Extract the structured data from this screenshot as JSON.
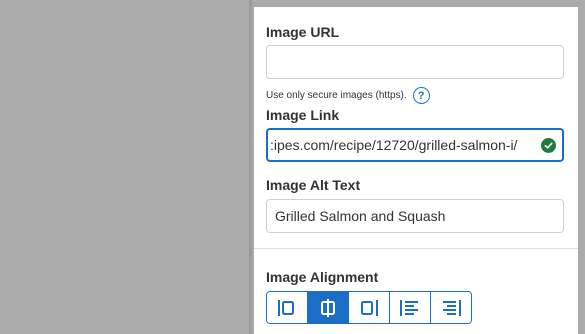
{
  "image_url": {
    "label": "Image URL",
    "value": "",
    "hint": "Use only secure images (https).",
    "help_icon": "?"
  },
  "image_link": {
    "label": "Image Link",
    "value": ":ipes.com/recipe/12720/grilled-salmon-i/",
    "status_icon": "check-circle-icon"
  },
  "image_alt": {
    "label": "Image Alt Text",
    "value": "Grilled Salmon and Squash"
  },
  "image_alignment": {
    "label": "Image Alignment",
    "options": [
      "align-left",
      "align-center",
      "align-right",
      "text-wrap-left",
      "text-wrap-right"
    ],
    "selected": "align-center"
  },
  "colors": {
    "accent": "#1a6ec8",
    "valid": "#1e7d3a",
    "backdrop": "#aaaaaa"
  }
}
